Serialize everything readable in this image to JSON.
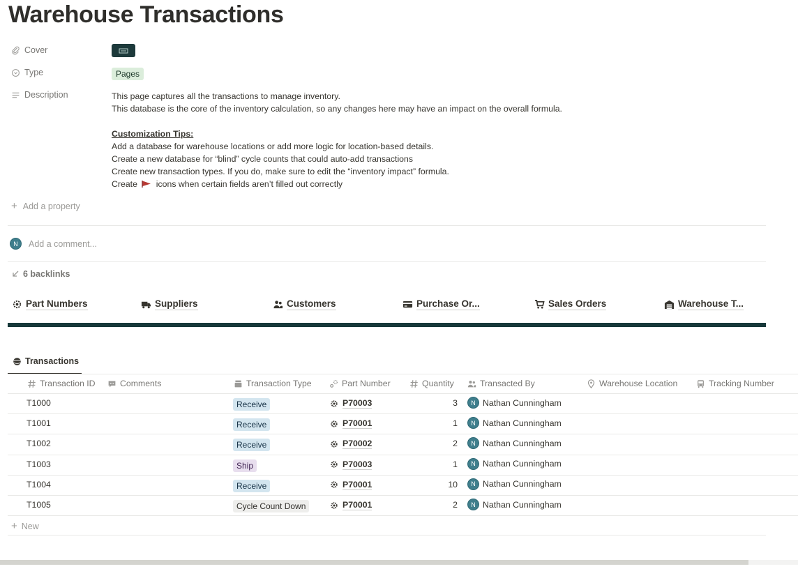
{
  "page": {
    "title": "Warehouse Transactions"
  },
  "properties": {
    "cover_label": "Cover",
    "type_label": "Type",
    "type_value": "Pages",
    "description_label": "Description",
    "description_lines": [
      "This page captures all the transactions to manage inventory.",
      "This database is the core of the inventory calculation, so any changes here may have an impact on the overall formula."
    ],
    "tips_heading": "Customization Tips:",
    "tips": [
      "Add a database for warehouse locations or add more logic for location-based details.",
      "Create a new database for “blind” cycle counts that could auto-add transactions",
      "Create new transaction types. If you do, make sure to edit the “inventory impact” formula."
    ],
    "tip_flag_prefix": "Create",
    "tip_flag_suffix": "icons when certain fields aren’t filled out correctly",
    "add_property": "Add a property"
  },
  "comment": {
    "avatar_initial": "N",
    "placeholder": "Add a comment..."
  },
  "backlinks": {
    "label": "6 backlinks"
  },
  "nav_links": [
    {
      "label": "Part Numbers",
      "icon": "gear-icon"
    },
    {
      "label": "Suppliers",
      "icon": "truck-icon"
    },
    {
      "label": "Customers",
      "icon": "people-icon"
    },
    {
      "label": "Purchase Or...",
      "icon": "credit-card-icon"
    },
    {
      "label": "Sales Orders",
      "icon": "cart-icon"
    },
    {
      "label": "Warehouse T...",
      "icon": "warehouse-icon"
    }
  ],
  "view": {
    "tab_label": "Transactions"
  },
  "table": {
    "columns": [
      {
        "label": "Transaction ID",
        "icon": "hash-icon"
      },
      {
        "label": "Comments",
        "icon": "comment-icon"
      },
      {
        "label": "Transaction Type",
        "icon": "select-icon"
      },
      {
        "label": "Part Number",
        "icon": "relation-icon"
      },
      {
        "label": "Quantity",
        "icon": "hash-icon"
      },
      {
        "label": "Transacted By",
        "icon": "people-icon"
      },
      {
        "label": "Warehouse Location",
        "icon": "location-pin-icon"
      },
      {
        "label": "Tracking Number",
        "icon": "bus-icon"
      }
    ],
    "rows": [
      {
        "id": "T1000",
        "type": "Receive",
        "part": "P70003",
        "qty": "3",
        "by": "Nathan Cunningham",
        "by_initial": "N"
      },
      {
        "id": "T1001",
        "type": "Receive",
        "part": "P70001",
        "qty": "1",
        "by": "Nathan Cunningham",
        "by_initial": "N"
      },
      {
        "id": "T1002",
        "type": "Receive",
        "part": "P70002",
        "qty": "2",
        "by": "Nathan Cunningham",
        "by_initial": "N"
      },
      {
        "id": "T1003",
        "type": "Ship",
        "part": "P70003",
        "qty": "1",
        "by": "Nathan Cunningham",
        "by_initial": "N"
      },
      {
        "id": "T1004",
        "type": "Receive",
        "part": "P70001",
        "qty": "10",
        "by": "Nathan Cunningham",
        "by_initial": "N"
      },
      {
        "id": "T1005",
        "type": "Cycle Count Down",
        "part": "P70001",
        "qty": "2",
        "by": "Nathan Cunningham",
        "by_initial": "N"
      }
    ],
    "new_label": "New"
  },
  "colors": {
    "accent_dark": "#17383a",
    "receive_tag": "#d3e5ef",
    "ship_tag": "#e8deee",
    "cycle_tag": "#eeeeec",
    "pages_tag": "#dbeddb",
    "avatar": "#3f7e8c"
  }
}
